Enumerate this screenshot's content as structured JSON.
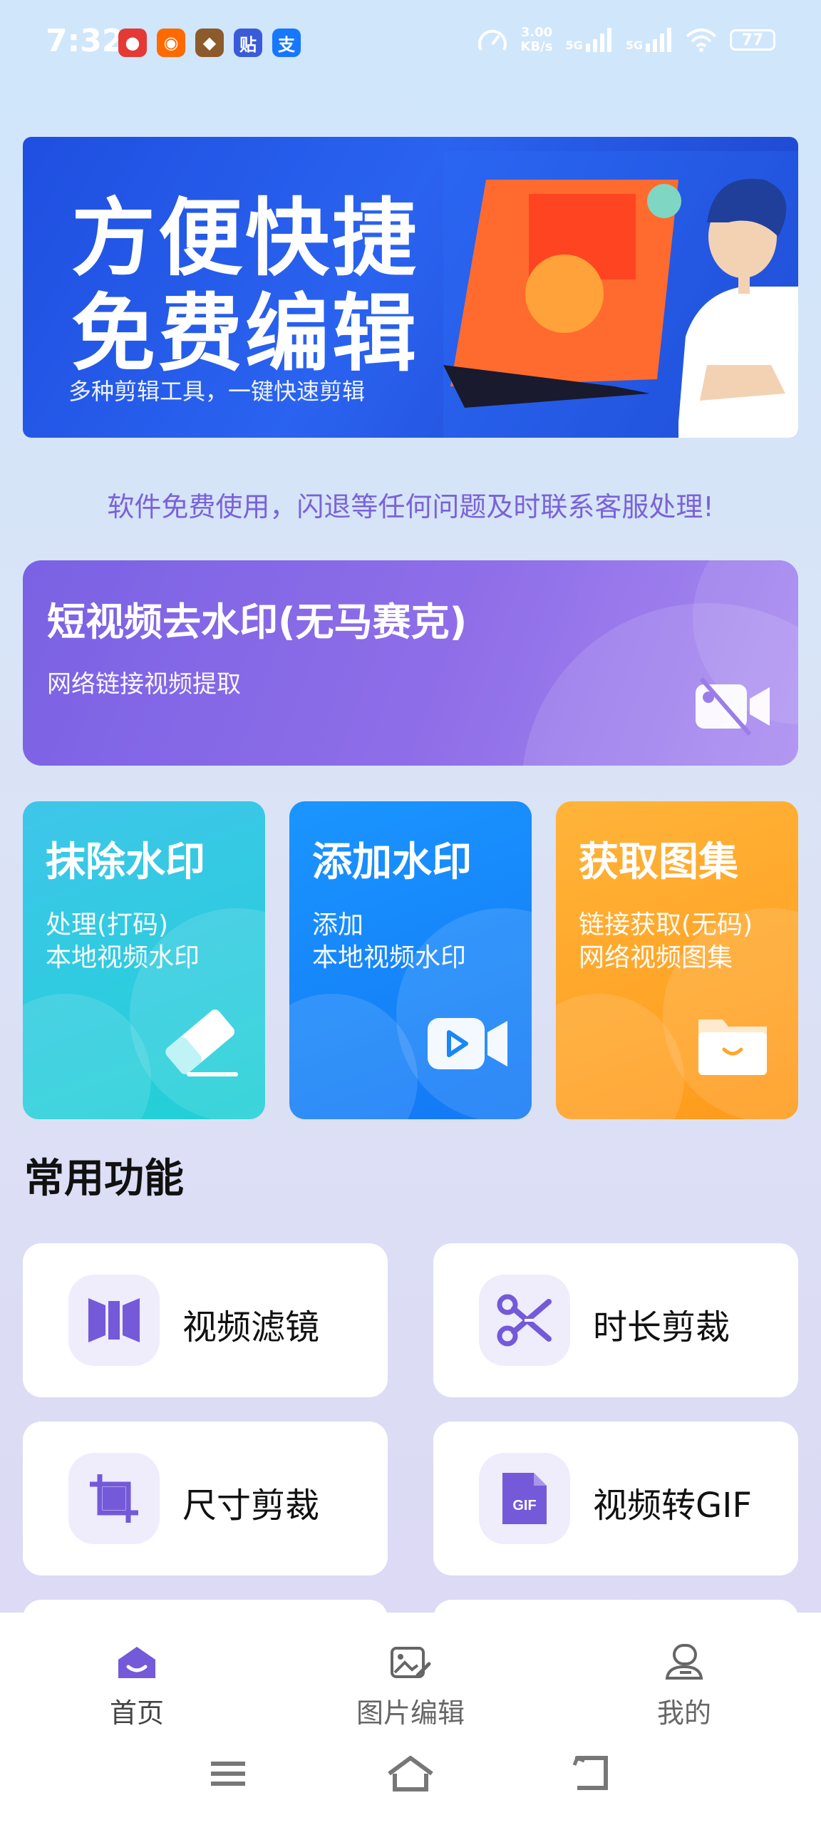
{
  "status_bar": {
    "time": "7:32",
    "apps": [
      {
        "icon": "game-app-icon",
        "text": "",
        "color": "#e53935"
      },
      {
        "icon": "shop-app-icon",
        "text": "",
        "color": "#ff6a00"
      },
      {
        "icon": "hero-game-icon",
        "text": "",
        "color": "#8d5a2b"
      },
      {
        "icon": "tieba-app-icon",
        "text": "贴",
        "color": "#3a5bd9"
      },
      {
        "icon": "alipay-app-icon",
        "text": "支",
        "color": "#1677ff"
      }
    ],
    "net_speed_value": "3.00",
    "net_speed_unit": "KB/s",
    "signal1_label": "5G",
    "signal2_label": "5G",
    "battery": "77"
  },
  "banner": {
    "line1": "方便快捷",
    "line2": "免费编辑",
    "subtitle": "多种剪辑工具，一键快速剪辑"
  },
  "notice": "软件免费使用，闪退等任何问题及时联系客服处理!",
  "promo": {
    "title": "短视频去水印(无马赛克)",
    "subtitle": "网络链接视频提取",
    "icon": "video-off-icon"
  },
  "feature_cards": [
    {
      "title": "抹除水印",
      "line1": "处理(打码)",
      "line2": "本地视频水印",
      "icon": "eraser-icon"
    },
    {
      "title": "添加水印",
      "line1": "添加",
      "line2": "本地视频水印",
      "icon": "video-play-icon"
    },
    {
      "title": "获取图集",
      "line1": "链接获取(无码)",
      "line2": "网络视频图集",
      "icon": "folder-icon"
    }
  ],
  "section": {
    "title": "常用功能"
  },
  "functions": [
    {
      "label": "视频滤镜",
      "icon": "filter-icon"
    },
    {
      "label": "时长剪裁",
      "icon": "scissors-icon"
    },
    {
      "label": "尺寸剪裁",
      "icon": "crop-icon"
    },
    {
      "label": "视频转GIF",
      "icon": "gif-icon",
      "icon_text": "GIF"
    }
  ],
  "bottom_nav": [
    {
      "label": "首页",
      "icon": "home-icon",
      "active": true
    },
    {
      "label": "图片编辑",
      "icon": "image-edit-icon",
      "active": false
    },
    {
      "label": "我的",
      "icon": "profile-icon",
      "active": false
    }
  ],
  "colors": {
    "accent": "#7a62d9",
    "promo": "#8f6ee8",
    "card_teal": "#20d0d6",
    "card_blue": "#1378f5",
    "card_orange": "#ff9a1a"
  }
}
